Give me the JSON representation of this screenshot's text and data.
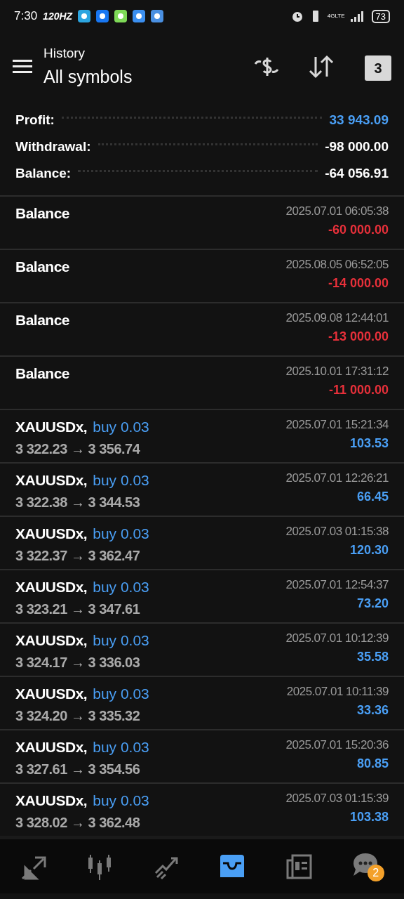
{
  "status_bar": {
    "time": "7:30",
    "refresh_rate": "120HZ",
    "network": "4GLTE",
    "battery": "73"
  },
  "toolbar": {
    "subtitle": "History",
    "title": "All symbols",
    "calendar_day": "3"
  },
  "summary": [
    {
      "label": "Profit:",
      "value": "33 943.09",
      "highlight": true
    },
    {
      "label": "Withdrawal:",
      "value": "-98 000.00",
      "highlight": false
    },
    {
      "label": "Balance:",
      "value": "-64 056.91",
      "highlight": false
    }
  ],
  "deals": [
    {
      "kind": "balance",
      "title": "Balance",
      "time": "2025.07.01 06:05:38",
      "amount": "-60 000.00",
      "color": "#e8303a"
    },
    {
      "kind": "balance",
      "title": "Balance",
      "time": "2025.08.05 06:52:05",
      "amount": "-14 000.00",
      "color": "#e8303a"
    },
    {
      "kind": "balance",
      "title": "Balance",
      "time": "2025.09.08 12:44:01",
      "amount": "-13 000.00",
      "color": "#e8303a"
    },
    {
      "kind": "balance",
      "title": "Balance",
      "time": "2025.10.01 17:31:12",
      "amount": "-11 000.00",
      "color": "#e8303a"
    },
    {
      "kind": "trade",
      "title": "XAUUSDx,",
      "side": "buy 0.03",
      "prices": "3 322.23 → 3 356.74",
      "time": "2025.07.01 15:21:34",
      "amount": "103.53",
      "color": "#4a9ff5"
    },
    {
      "kind": "trade",
      "title": "XAUUSDx,",
      "side": "buy 0.03",
      "prices": "3 322.38 → 3 344.53",
      "time": "2025.07.01 12:26:21",
      "amount": "66.45",
      "color": "#4a9ff5"
    },
    {
      "kind": "trade",
      "title": "XAUUSDx,",
      "side": "buy 0.03",
      "prices": "3 322.37 → 3 362.47",
      "time": "2025.07.03 01:15:38",
      "amount": "120.30",
      "color": "#4a9ff5"
    },
    {
      "kind": "trade",
      "title": "XAUUSDx,",
      "side": "buy 0.03",
      "prices": "3 323.21 → 3 347.61",
      "time": "2025.07.01 12:54:37",
      "amount": "73.20",
      "color": "#4a9ff5"
    },
    {
      "kind": "trade",
      "title": "XAUUSDx,",
      "side": "buy 0.03",
      "prices": "3 324.17 → 3 336.03",
      "time": "2025.07.01 10:12:39",
      "amount": "35.58",
      "color": "#4a9ff5"
    },
    {
      "kind": "trade",
      "title": "XAUUSDx,",
      "side": "buy 0.03",
      "prices": "3 324.20 → 3 335.32",
      "time": "2025.07.01 10:11:39",
      "amount": "33.36",
      "color": "#4a9ff5"
    },
    {
      "kind": "trade",
      "title": "XAUUSDx,",
      "side": "buy 0.03",
      "prices": "3 327.61 → 3 354.56",
      "time": "2025.07.01 15:20:36",
      "amount": "80.85",
      "color": "#4a9ff5"
    },
    {
      "kind": "trade",
      "title": "XAUUSDx,",
      "side": "buy 0.03",
      "prices": "3 328.02 → 3 362.48",
      "time": "2025.07.03 01:15:39",
      "amount": "103.38",
      "color": "#4a9ff5"
    }
  ],
  "nav": [
    {
      "kind": "trade",
      "selected": false
    },
    {
      "kind": "quotes",
      "selected": false
    },
    {
      "kind": "chart",
      "selected": false
    },
    {
      "kind": "history",
      "selected": true
    },
    {
      "kind": "news",
      "selected": false
    },
    {
      "kind": "chat",
      "selected": false,
      "badge": "2"
    }
  ]
}
